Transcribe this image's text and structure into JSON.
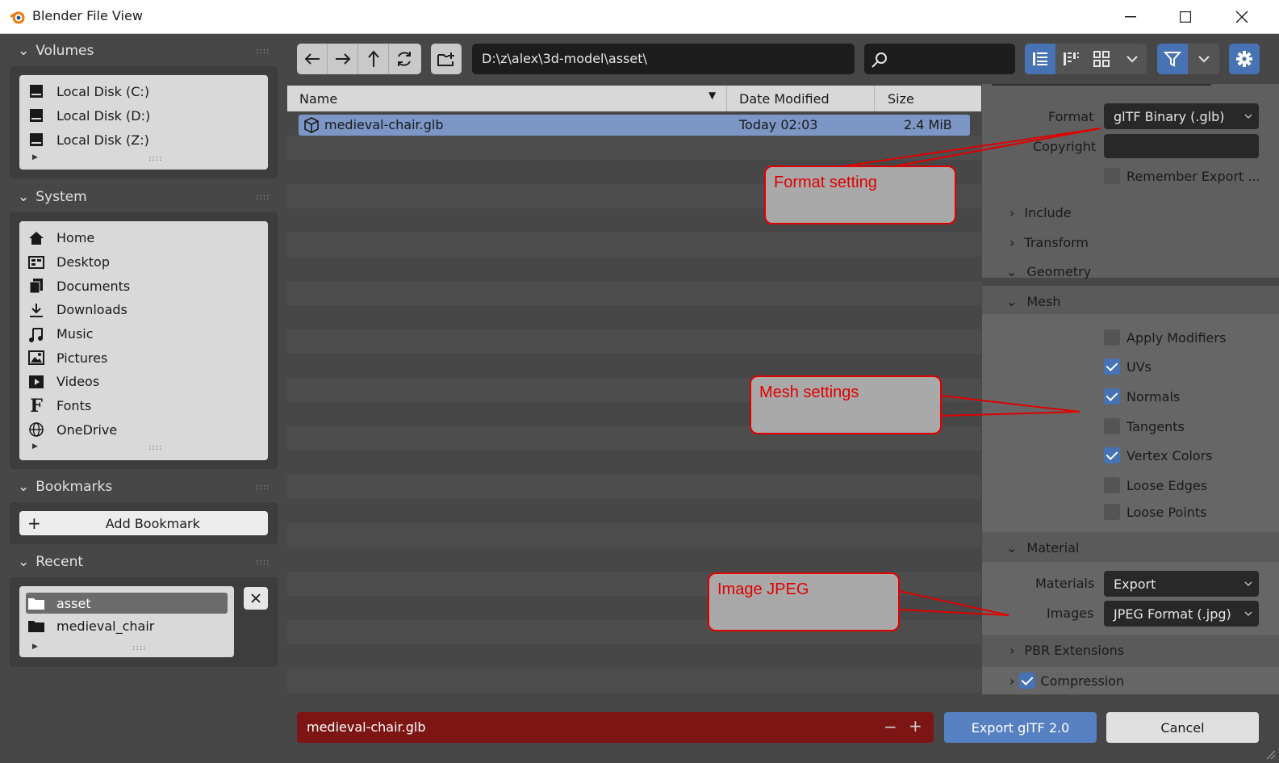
{
  "window": {
    "title": "Blender File View"
  },
  "sidebar": {
    "volumes": {
      "title": "Volumes",
      "items": [
        {
          "label": "Local Disk (C:)",
          "icon": "disk-icon"
        },
        {
          "label": "Local Disk (D:)",
          "icon": "disk-icon"
        },
        {
          "label": "Local Disk (Z:)",
          "icon": "disk-icon"
        }
      ]
    },
    "system": {
      "title": "System",
      "items": [
        {
          "label": "Home",
          "icon": "home-icon"
        },
        {
          "label": "Desktop",
          "icon": "desktop-icon"
        },
        {
          "label": "Documents",
          "icon": "documents-icon"
        },
        {
          "label": "Downloads",
          "icon": "download-icon"
        },
        {
          "label": "Music",
          "icon": "music-icon"
        },
        {
          "label": "Pictures",
          "icon": "pictures-icon"
        },
        {
          "label": "Videos",
          "icon": "videos-icon"
        },
        {
          "label": "Fonts",
          "icon": "fonts-icon"
        },
        {
          "label": "OneDrive",
          "icon": "globe-icon"
        }
      ]
    },
    "bookmarks": {
      "title": "Bookmarks",
      "add_label": "Add Bookmark"
    },
    "recent": {
      "title": "Recent",
      "items": [
        {
          "label": "asset",
          "icon": "folder-icon"
        },
        {
          "label": "medieval_chair",
          "icon": "folder-icon"
        }
      ]
    }
  },
  "toolbar": {
    "path": "D:\\z\\alex\\3d-model\\asset\\",
    "search_placeholder": ""
  },
  "filelist": {
    "columns": {
      "name": "Name",
      "date": "Date Modified",
      "size": "Size"
    },
    "files": [
      {
        "name": "medieval-chair.glb",
        "date": "Today 02:03",
        "size": "2.4 MiB"
      }
    ]
  },
  "settings": {
    "format_label": "Format",
    "format_value": "glTF Binary (.glb)",
    "copyright_label": "Copyright",
    "copyright_value": "",
    "remember_label": "Remember Export ...",
    "include": "Include",
    "transform": "Transform",
    "geometry": "Geometry",
    "mesh": "Mesh",
    "mesh_options": {
      "apply_modifiers": "Apply Modifiers",
      "uvs": "UVs",
      "normals": "Normals",
      "tangents": "Tangents",
      "vertex_colors": "Vertex Colors",
      "loose_edges": "Loose Edges",
      "loose_points": "Loose Points"
    },
    "mesh_checked": {
      "apply_modifiers": false,
      "uvs": true,
      "normals": true,
      "tangents": false,
      "vertex_colors": true,
      "loose_edges": false,
      "loose_points": false
    },
    "material": "Material",
    "materials_label": "Materials",
    "materials_value": "Export",
    "images_label": "Images",
    "images_value": "JPEG Format (.jpg)",
    "pbr": "PBR Extensions",
    "compression": "Compression"
  },
  "callouts": {
    "format": "Format setting",
    "mesh": "Mesh settings",
    "image": "Image JPEG"
  },
  "bottom": {
    "filename": "medieval-chair.glb",
    "export_label": "Export glTF 2.0",
    "cancel_label": "Cancel"
  },
  "colors": {
    "accent": "#4772b3",
    "filename_bg": "#7d1515",
    "export_bg": "#5680c2",
    "callout": "#e00000"
  }
}
